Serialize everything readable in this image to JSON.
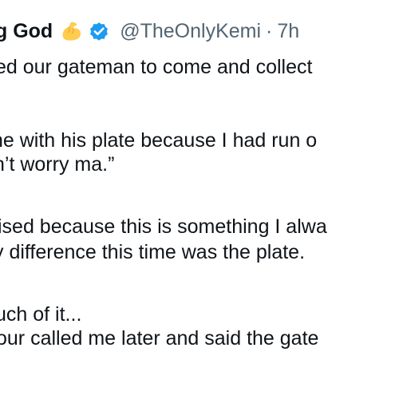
{
  "author": {
    "display_name_fragment": "g God",
    "emoji_icon": "flexed-biceps-icon",
    "verified_icon": "verified-badge-icon",
    "verified_color": "#1d9bf0",
    "handle": "@TheOnlyKemi",
    "separator": "·",
    "timestamp": "7h"
  },
  "body_lines": [
    "ed our gateman to come and collect",
    "ne with his plate because I had run o",
    "n’t worry ma.”",
    "ised because this is something I alwa",
    "y difference this time was the plate.",
    "uch of it...",
    "our called me later and said the gate"
  ]
}
